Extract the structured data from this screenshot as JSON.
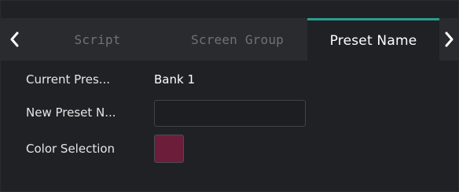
{
  "tabs": [
    {
      "label": "Script",
      "active": false
    },
    {
      "label": "Screen Group",
      "active": false
    },
    {
      "label": "Preset Name",
      "active": true
    }
  ],
  "icons": {
    "prev": "chevron-left-icon",
    "next": "chevron-right-icon"
  },
  "form": {
    "current_preset": {
      "label": "Current Pres...",
      "value": "Bank 1"
    },
    "new_preset": {
      "label": "New Preset N...",
      "value": "",
      "placeholder": ""
    },
    "color_selection": {
      "label": "Color Selection",
      "color": "#6b1d3a"
    }
  },
  "colors": {
    "accent": "#2a9d8f",
    "background": "#202124",
    "tabbar": "#2a2b2e"
  }
}
